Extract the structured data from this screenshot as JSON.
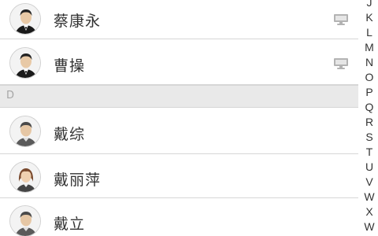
{
  "contacts": [
    {
      "name": "蔡康永",
      "avatar": "male-suit-avatar",
      "device": "desktop-icon"
    },
    {
      "name": "曹操",
      "avatar": "male-suit-avatar",
      "device": "desktop-icon"
    },
    {
      "name": "戴综",
      "avatar": "male-casual-avatar",
      "device": null
    },
    {
      "name": "戴丽萍",
      "avatar": "female-avatar",
      "device": null
    },
    {
      "name": "戴立",
      "avatar": "male-casual-avatar",
      "device": null
    }
  ],
  "section_header": "D",
  "index_letters": [
    "J",
    "K",
    "L",
    "M",
    "N",
    "O",
    "P",
    "Q",
    "R",
    "S",
    "T",
    "U",
    "V",
    "W",
    "X",
    "W"
  ],
  "colors": {
    "divider": "#d6d6d6",
    "section_bg": "#e9e9e9",
    "device_icon": "#b3b3b3"
  }
}
